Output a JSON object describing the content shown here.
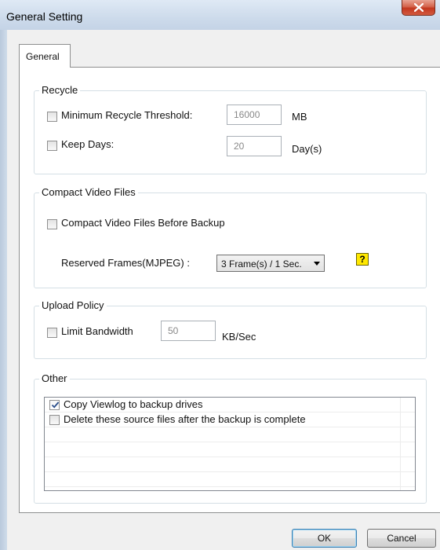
{
  "window": {
    "title": "General Setting"
  },
  "tabs": [
    {
      "label": "General"
    }
  ],
  "recycle": {
    "legend": "Recycle",
    "min_threshold": {
      "label": "Minimum Recycle Threshold:",
      "value": "16000",
      "unit": "MB",
      "checked": false
    },
    "keep_days": {
      "label": "Keep Days:",
      "value": "20",
      "unit": "Day(s)",
      "checked": false
    }
  },
  "compact": {
    "legend": "Compact Video Files",
    "before_backup": {
      "label": "Compact Video Files Before Backup",
      "checked": false
    },
    "reserved_frames": {
      "label": "Reserved Frames(MJPEG) :",
      "value": "3 Frame(s) / 1 Sec."
    },
    "help_glyph": "?"
  },
  "upload": {
    "legend": "Upload Policy",
    "limit_bandwidth": {
      "label": "Limit Bandwidth",
      "value": "50",
      "unit": "KB/Sec",
      "checked": false
    }
  },
  "other": {
    "legend": "Other",
    "items": [
      {
        "label": "Copy Viewlog to backup drives",
        "checked": true
      },
      {
        "label": "Delete these source files after the backup is complete",
        "checked": false
      }
    ]
  },
  "buttons": {
    "ok": "OK",
    "cancel": "Cancel"
  },
  "icons": {
    "close": "close-icon",
    "check": "checkmark-icon",
    "help": "help-icon",
    "dropdown": "chevron-down-icon"
  },
  "colors": {
    "title_gradient_top": "#dfe9f5",
    "close_button": "#c3381f",
    "help_icon": "#ffe800"
  }
}
